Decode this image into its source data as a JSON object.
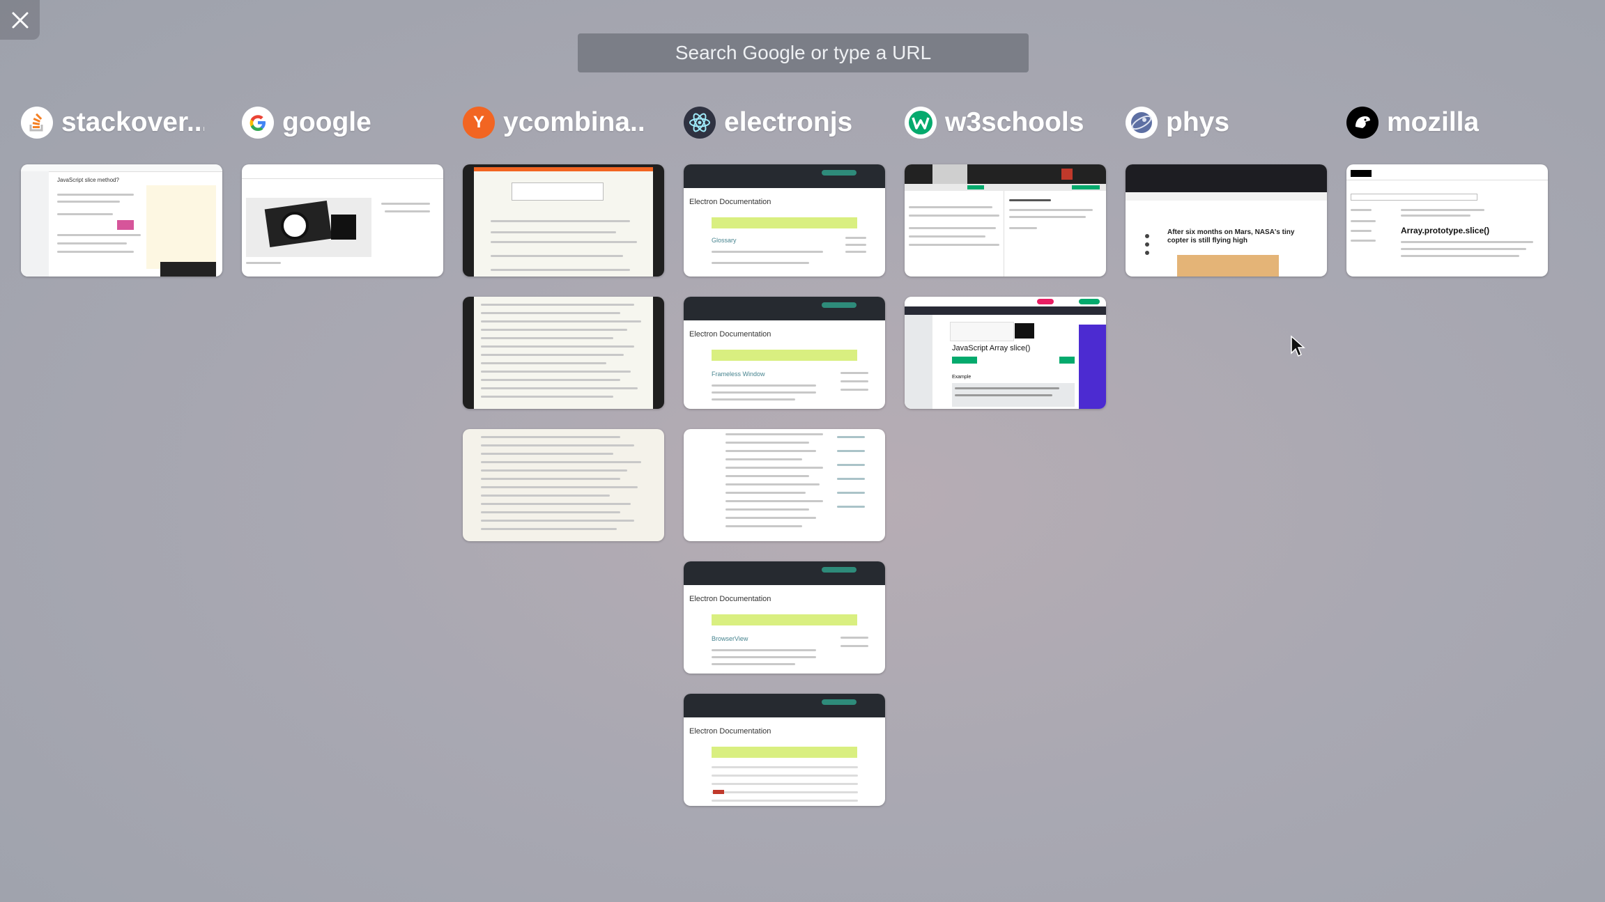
{
  "search": {
    "placeholder": "Search Google or type a URL"
  },
  "close": {
    "icon": "close-icon"
  },
  "columns": [
    {
      "title": "stackover...",
      "icon": "stackoverflow-icon",
      "icon_color": "#f48024"
    },
    {
      "title": "google",
      "icon": "google-icon",
      "icon_color": "#ffffff"
    },
    {
      "title": "ycombina...",
      "icon": "ycombinator-icon",
      "icon_color": "#f26522",
      "icon_letter": "Y"
    },
    {
      "title": "electronjs",
      "icon": "electron-icon",
      "icon_color": "#9feaf9"
    },
    {
      "title": "w3schools",
      "icon": "w3schools-icon",
      "icon_color": "#04aa6d"
    },
    {
      "title": "phys",
      "icon": "phys-icon",
      "icon_color": "#9aa7c7"
    },
    {
      "title": "mozilla",
      "icon": "mozilla-icon",
      "icon_color": "#000000"
    }
  ],
  "thumbs": {
    "stackoverflow": {
      "heading": "JavaScript slice method?"
    },
    "electron_1": {
      "title": "Electron Documentation",
      "section": "Glossary"
    },
    "electron_2": {
      "title": "Electron Documentation",
      "section": "Frameless Window"
    },
    "electron_3": {
      "title": "Electron Documentation",
      "section": "BrowserView"
    },
    "electron_4": {
      "title": "Electron Documentation"
    },
    "w3schools_2": {
      "heading": "JavaScript Array slice()",
      "section": "Example"
    },
    "phys": {
      "headline": "After six months on Mars, NASA's tiny copter is still flying high"
    },
    "mozilla": {
      "heading": "Array.prototype.slice()"
    }
  }
}
